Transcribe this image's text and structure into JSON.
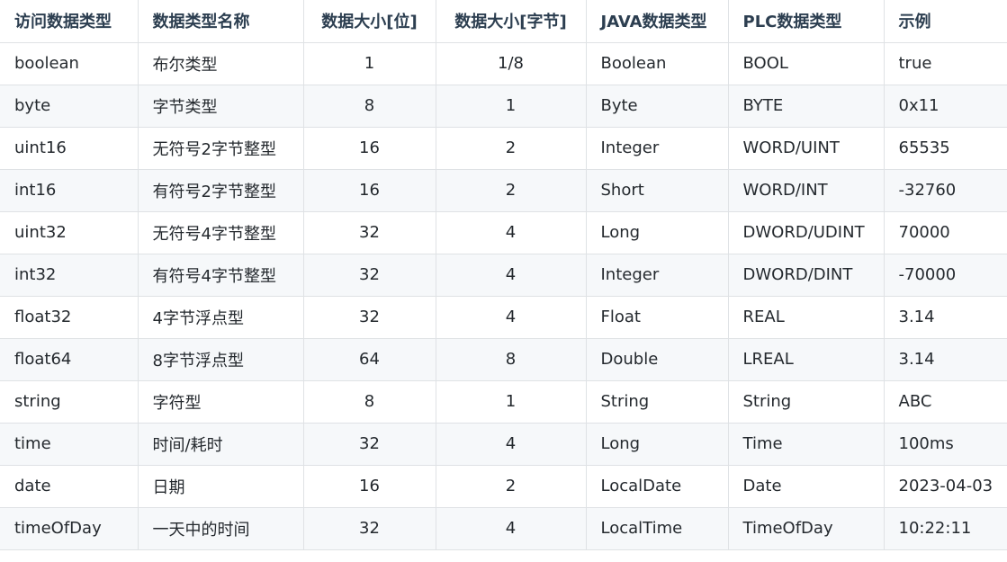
{
  "headers": [
    "访问数据类型",
    "数据类型名称",
    "数据大小[位]",
    "数据大小[字节]",
    "JAVA数据类型",
    "PLC数据类型",
    "示例"
  ],
  "rows": [
    [
      "boolean",
      "布尔类型",
      "1",
      "1/8",
      "Boolean",
      "BOOL",
      "true"
    ],
    [
      "byte",
      "字节类型",
      "8",
      "1",
      "Byte",
      "BYTE",
      "0x11"
    ],
    [
      "uint16",
      "无符号2字节整型",
      "16",
      "2",
      "Integer",
      "WORD/UINT",
      "65535"
    ],
    [
      "int16",
      "有符号2字节整型",
      "16",
      "2",
      "Short",
      "WORD/INT",
      "-32760"
    ],
    [
      "uint32",
      "无符号4字节整型",
      "32",
      "4",
      "Long",
      "DWORD/UDINT",
      "70000"
    ],
    [
      "int32",
      "有符号4字节整型",
      "32",
      "4",
      "Integer",
      "DWORD/DINT",
      "-70000"
    ],
    [
      "float32",
      "4字节浮点型",
      "32",
      "4",
      "Float",
      "REAL",
      "3.14"
    ],
    [
      "float64",
      "8字节浮点型",
      "64",
      "8",
      "Double",
      "LREAL",
      "3.14"
    ],
    [
      "string",
      "字符型",
      "8",
      "1",
      "String",
      "String",
      "ABC"
    ],
    [
      "time",
      "时间/耗时",
      "32",
      "4",
      "Long",
      "Time",
      "100ms"
    ],
    [
      "date",
      "日期",
      "16",
      "2",
      "LocalDate",
      "Date",
      "2023-04-03"
    ],
    [
      "timeOfDay",
      "一天中的时间",
      "32",
      "4",
      "LocalTime",
      "TimeOfDay",
      "10:22:11"
    ]
  ]
}
